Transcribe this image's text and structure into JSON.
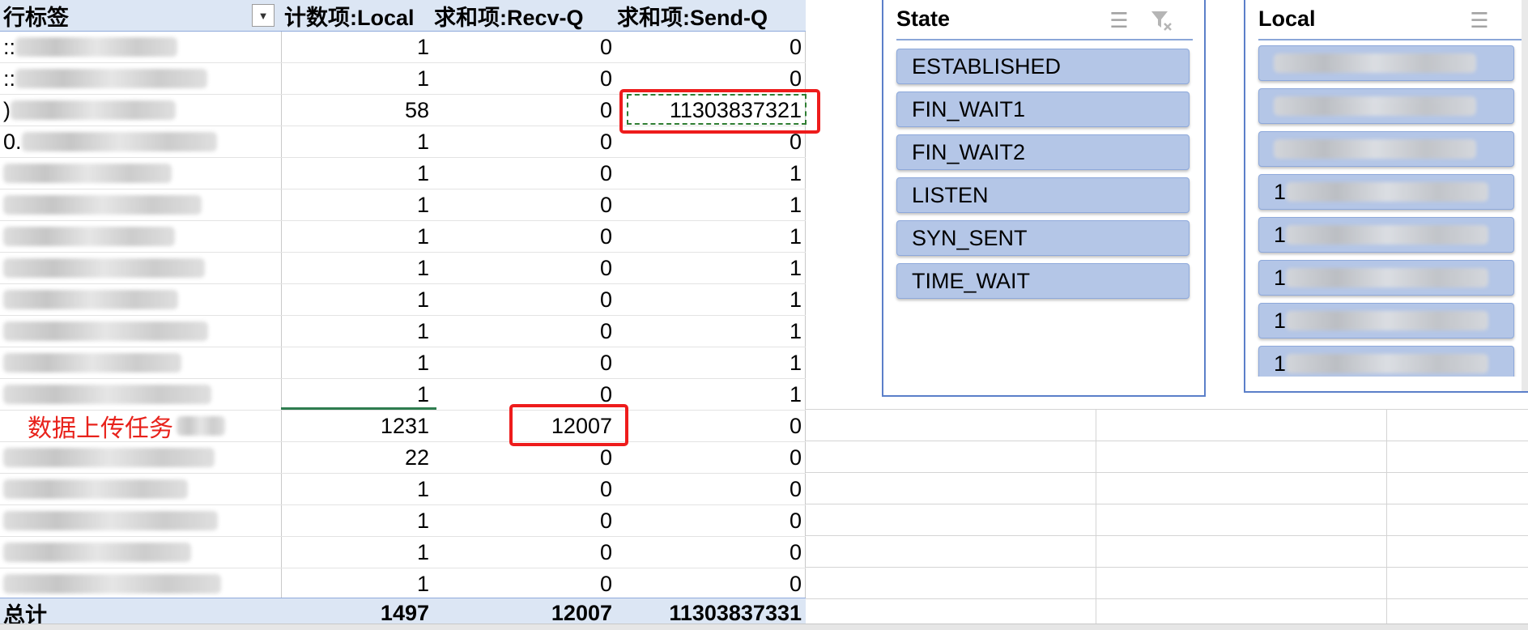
{
  "pivot": {
    "headers": [
      "行标签",
      "计数项:Local",
      "求和项:Recv-Q",
      "求和项:Send-Q"
    ],
    "rows": [
      {
        "label": "::",
        "local": "1",
        "recv": "0",
        "send": "0"
      },
      {
        "label": "::",
        "local": "1",
        "recv": "0",
        "send": "0"
      },
      {
        "label": ")",
        "local": "58",
        "recv": "0",
        "send": "11303837321"
      },
      {
        "label": "0.",
        "local": "1",
        "recv": "0",
        "send": "0"
      },
      {
        "label": "",
        "local": "1",
        "recv": "0",
        "send": "1"
      },
      {
        "label": "",
        "local": "1",
        "recv": "0",
        "send": "1"
      },
      {
        "label": "",
        "local": "1",
        "recv": "0",
        "send": "1"
      },
      {
        "label": "",
        "local": "1",
        "recv": "0",
        "send": "1"
      },
      {
        "label": "",
        "local": "1",
        "recv": "0",
        "send": "1"
      },
      {
        "label": "",
        "local": "1",
        "recv": "0",
        "send": "1"
      },
      {
        "label": "",
        "local": "1",
        "recv": "0",
        "send": "1"
      },
      {
        "label": "",
        "local": "1",
        "recv": "0",
        "send": "1"
      },
      {
        "label": "数据上传任务",
        "local": "1231",
        "recv": "12007",
        "send": "0"
      },
      {
        "label": "",
        "local": "22",
        "recv": "0",
        "send": "0"
      },
      {
        "label": "",
        "local": "1",
        "recv": "0",
        "send": "0"
      },
      {
        "label": "",
        "local": "1",
        "recv": "0",
        "send": "0"
      },
      {
        "label": "",
        "local": "1",
        "recv": "0",
        "send": "0"
      },
      {
        "label": "",
        "local": "1",
        "recv": "0",
        "send": "0"
      }
    ],
    "total": {
      "label": "总计",
      "local": "1497",
      "recv": "12007",
      "send": "11303837331"
    }
  },
  "state_slicer": {
    "title": "State",
    "items": [
      "ESTABLISHED",
      "FIN_WAIT1",
      "FIN_WAIT2",
      "LISTEN",
      "SYN_SENT",
      "TIME_WAIT"
    ],
    "icons": [
      "multi-select-icon",
      "clear-filter-icon"
    ]
  },
  "local_slicer": {
    "title": "Local",
    "items": [
      "",
      "",
      "",
      "1",
      "1",
      "1",
      "1",
      "1"
    ],
    "icons": [
      "multi-select-icon"
    ]
  },
  "colors": {
    "header_fill": "#dce6f4",
    "slicer_button": "#b4c6e7",
    "slicer_border": "#5b7fc9",
    "annotation_red": "#e8221b"
  }
}
